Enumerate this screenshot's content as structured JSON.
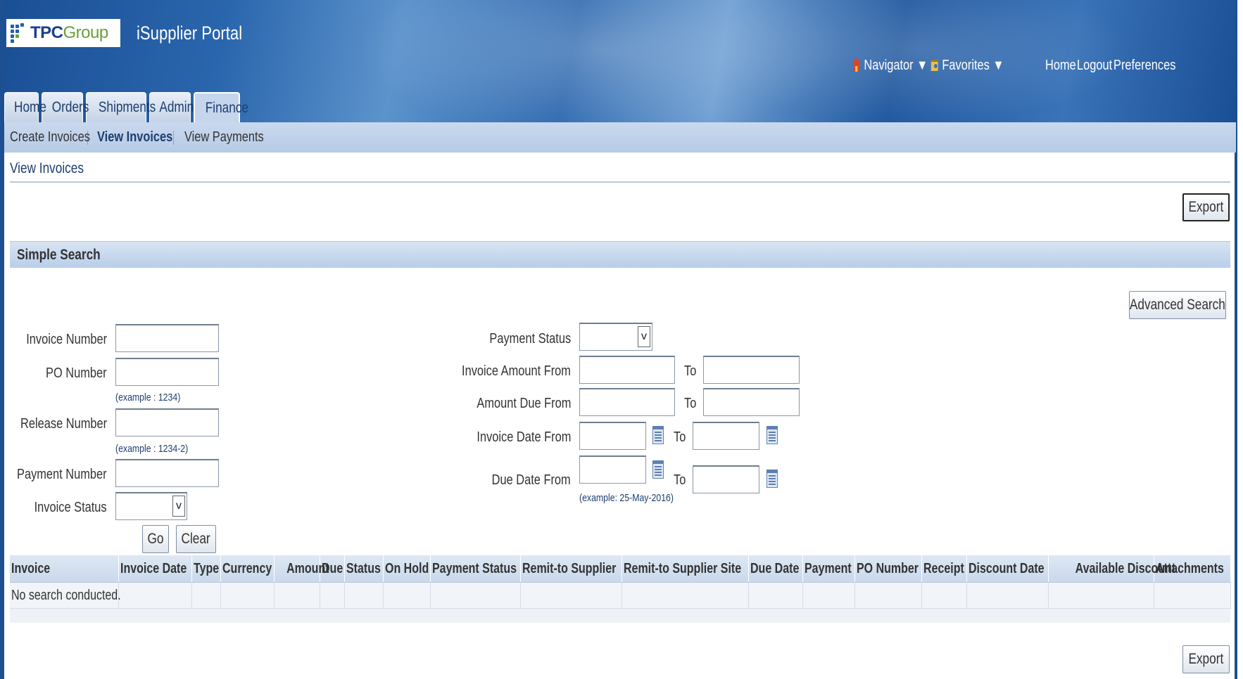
{
  "header": {
    "logo": {
      "text_bold": "TPC",
      "text_light": "Group"
    },
    "title": "iSupplier Portal",
    "global_links": {
      "navigator": "Navigator ▼",
      "favorites": "Favorites ▼",
      "home": "Home",
      "logout": "Logout",
      "preferences": "Preferences"
    }
  },
  "tabs": [
    "Home",
    "Orders",
    "Shipments",
    "Admin",
    "Finance"
  ],
  "active_tab": "Finance",
  "subnav": [
    "Create Invoices",
    "View Invoices",
    "View Payments"
  ],
  "active_subnav": "View Invoices",
  "page": {
    "title": "View Invoices",
    "export_label": "Export"
  },
  "search": {
    "section_title": "Simple Search",
    "advanced_label": "Advanced Search",
    "left_fields": {
      "invoice_number": {
        "label": "Invoice Number",
        "value": ""
      },
      "po_number": {
        "label": "PO Number",
        "value": "",
        "hint": "(example : 1234)"
      },
      "release_number": {
        "label": "Release Number",
        "value": "",
        "hint": "(example : 1234-2)"
      },
      "payment_number": {
        "label": "Payment Number",
        "value": ""
      },
      "invoice_status": {
        "label": "Invoice Status",
        "value": ""
      }
    },
    "right_fields": {
      "payment_status": {
        "label": "Payment Status",
        "value": ""
      },
      "invoice_amount_from": {
        "label": "Invoice Amount From",
        "to": "To"
      },
      "amount_due_from": {
        "label": "Amount Due From",
        "to": "To"
      },
      "invoice_date_from": {
        "label": "Invoice Date From",
        "to": "To"
      },
      "due_date_from": {
        "label": "Due Date From",
        "to": "To",
        "hint": "(example: 25-May-2016)"
      }
    },
    "go_label": "Go",
    "clear_label": "Clear"
  },
  "results": {
    "columns": [
      "Invoice",
      "Invoice Date",
      "Type",
      "Currency",
      "Amount",
      "Due",
      "Status",
      "On Hold",
      "Payment Status",
      "Remit-to Supplier",
      "Remit-to Supplier Site",
      "Due Date",
      "Payment",
      "PO Number",
      "Receipt",
      "Discount Date",
      "Available Discount",
      "Attachments"
    ],
    "empty_message": "No search conducted."
  },
  "colors": {
    "header_blue": "#1b4f95",
    "subnav": "#c9d9ee",
    "link": "#1d3e6e"
  }
}
